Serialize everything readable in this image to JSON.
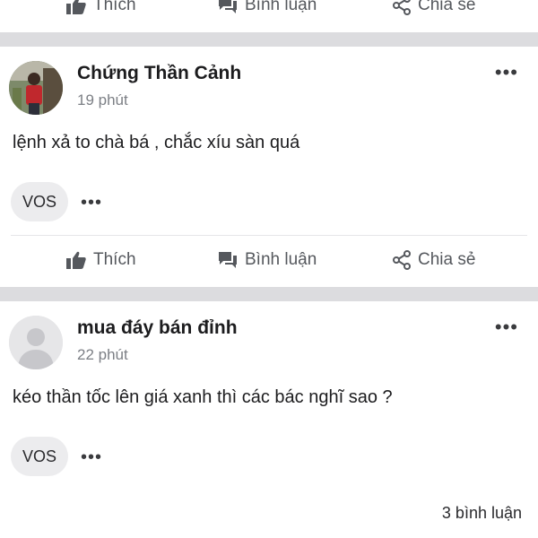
{
  "actions": {
    "like": "Thích",
    "comment": "Bình luận",
    "share": "Chia sẻ"
  },
  "posts": [
    {
      "author": "Chứng Thần Cảnh",
      "time": "19 phút",
      "content": "lệnh xả to chà bá , chắc xíu sàn quá",
      "chip": "VOS",
      "more_icon": "ellipsis-icon"
    },
    {
      "author": "mua đáy bán đỉnh",
      "time": "22 phút",
      "content": "kéo thần tốc lên giá xanh thì các bác nghĩ sao ?",
      "chip": "VOS",
      "more_icon": "ellipsis-icon",
      "comment_count": "3 bình luận"
    }
  ],
  "colors": {
    "divider": "#dcdcdf",
    "icon_gray": "#55585d",
    "chip_bg": "#ececee"
  }
}
